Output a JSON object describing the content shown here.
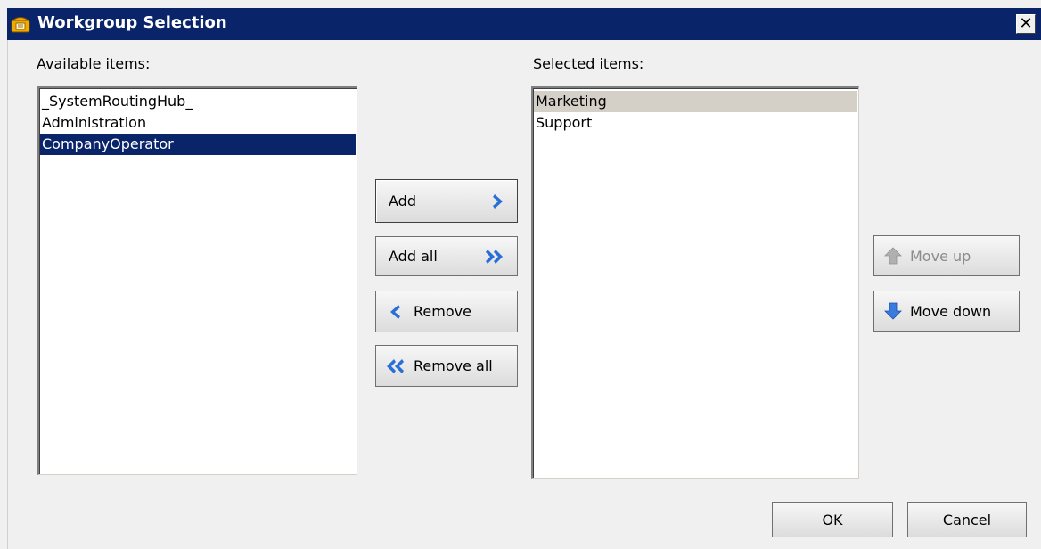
{
  "window": {
    "title": "Workgroup Selection",
    "close_glyph": "✕"
  },
  "available": {
    "label": "Available items:",
    "items": [
      "_SystemRoutingHub_",
      "Administration",
      "CompanyOperator"
    ],
    "selected_index": 2
  },
  "selected": {
    "label": "Selected items:",
    "items": [
      "Marketing",
      "Support"
    ],
    "focused_index": 0
  },
  "buttons": {
    "add": "Add",
    "add_all": "Add all",
    "remove": "Remove",
    "remove_all": "Remove all",
    "move_up": "Move up",
    "move_down": "Move down",
    "ok": "OK",
    "cancel": "Cancel"
  },
  "icons": {
    "add": "chevron-right-icon",
    "add_all": "double-chevron-right-icon",
    "remove": "chevron-left-icon",
    "remove_all": "double-chevron-left-icon",
    "move_up": "arrow-up-icon",
    "move_down": "arrow-down-icon",
    "title": "phone-icon"
  },
  "colors": {
    "titlebar": "#0a246a",
    "selection": "#0a246a",
    "arrow_blue": "#2a6fd6",
    "disabled_arrow": "#a0a0a0",
    "phone": "#f2a900"
  }
}
